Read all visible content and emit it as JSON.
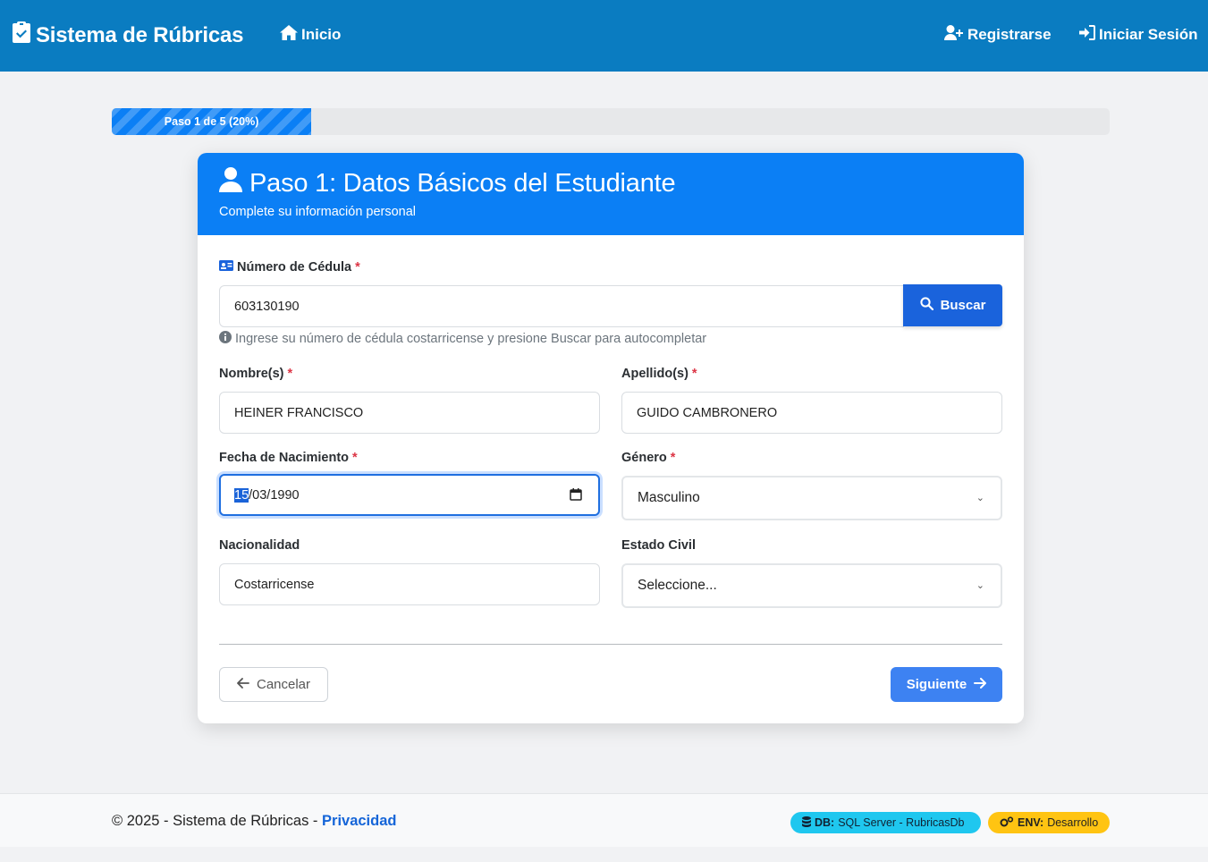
{
  "navbar": {
    "brand": "Sistema de Rúbricas",
    "brand_icon": "clipboard-check-icon",
    "home": "Inicio",
    "register": "Registrarse",
    "login": "Iniciar Sesión",
    "bg_color": "#0a7cc1"
  },
  "progress": {
    "label": "Paso 1 de 5 (20%)",
    "percent": 20
  },
  "card": {
    "title": "Paso 1: Datos Básicos del Estudiante",
    "subtitle": "Complete su información personal",
    "header_color": "#0b7ff5"
  },
  "form": {
    "cedula": {
      "label": "Número de Cédula",
      "value": "603130190",
      "help": "Ingrese su número de cédula costarricense y presione Buscar para autocompletar",
      "button": "Buscar"
    },
    "nombre": {
      "label": "Nombre(s)",
      "value": "HEINER FRANCISCO"
    },
    "apellido": {
      "label": "Apellido(s)",
      "value": "GUIDO CAMBRONERO"
    },
    "fecha": {
      "label": "Fecha de Nacimiento",
      "day": "15",
      "rest": "/03/1990"
    },
    "genero": {
      "label": "Género",
      "value": "Masculino"
    },
    "nacionalidad": {
      "label": "Nacionalidad",
      "value": "Costarricense"
    },
    "estado_civil": {
      "label": "Estado Civil",
      "value": "Seleccione..."
    },
    "required_mark": "*"
  },
  "actions": {
    "cancel": "Cancelar",
    "next": "Siguiente"
  },
  "footer": {
    "copyright": "© 2025 - Sistema de Rúbricas - ",
    "privacy": "Privacidad",
    "db_label": "DB:",
    "db_value": "SQL Server - RubricasDb",
    "env_label": "ENV:",
    "env_value": "Desarrollo"
  }
}
